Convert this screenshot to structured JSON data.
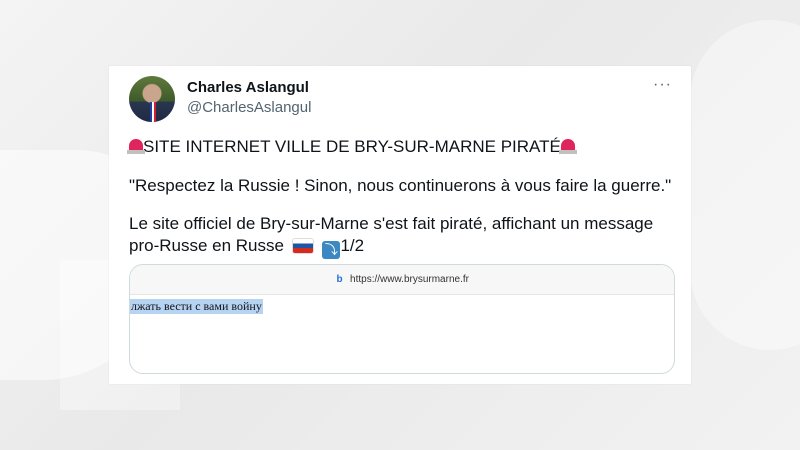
{
  "tweet": {
    "author_name": "Charles Aslangul",
    "author_handle": "@CharlesAslangul",
    "more_label": "···",
    "headline": "SITE INTERNET VILLE DE BRY-SUR-MARNE PIRATÉ",
    "quote": "\"Respectez la Russie ! Sinon, nous continuerons à vous faire la guerre.\"",
    "body_line1": "Le site officiel de Bry-sur-Marne s'est fait piraté, affichant un message",
    "body_line2": "pro-Russe en Russe",
    "thread_count": "1/2",
    "icons": [
      "siren-icon",
      "russian-flag-icon",
      "arrow-icon",
      "site-logo-icon"
    ],
    "preview": {
      "url": "https://www.brysurmarne.fr",
      "site_logo": "b",
      "highlighted_text": "лжать вести с вами войну"
    }
  },
  "colors": {
    "text": "#0f1419",
    "secondary": "#536471",
    "highlight": "#b7d3f2",
    "flag_blue": "#1c57a5",
    "flag_red": "#d52b1e",
    "arrow_blue": "#3b88c3"
  }
}
